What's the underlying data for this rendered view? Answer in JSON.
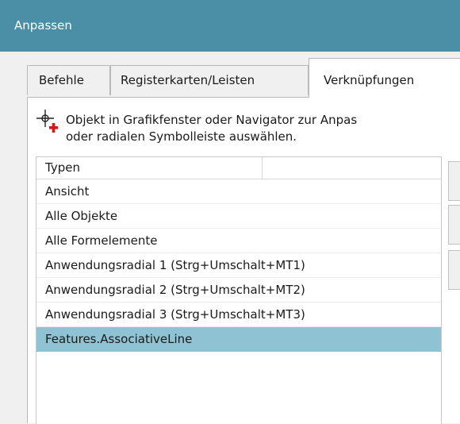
{
  "window": {
    "title": "Anpassen"
  },
  "tabs": [
    {
      "label": "Befehle"
    },
    {
      "label": "Registerkarten/Leisten"
    },
    {
      "label": "Verknüpfungen"
    }
  ],
  "hint": {
    "line1": "Objekt in Grafikfenster oder Navigator zur Anpas",
    "line2": "oder radialen Symbolleiste auswählen."
  },
  "list": {
    "columns": [
      "Typen",
      ""
    ],
    "rows": [
      {
        "label": "Ansicht"
      },
      {
        "label": "Alle Objekte"
      },
      {
        "label": "Alle Formelemente"
      },
      {
        "label": "Anwendungsradial 1 (Strg+Umschalt+MT1)"
      },
      {
        "label": "Anwendungsradial 2 (Strg+Umschalt+MT2)"
      },
      {
        "label": "Anwendungsradial 3 (Strg+Umschalt+MT3)"
      },
      {
        "label": "Features.AssociativeLine"
      }
    ],
    "selected_index": 6
  },
  "colors": {
    "titlebar": "#4b8fa6",
    "selection": "#8fc3d3",
    "cursor_plus": "#d11a1a"
  }
}
